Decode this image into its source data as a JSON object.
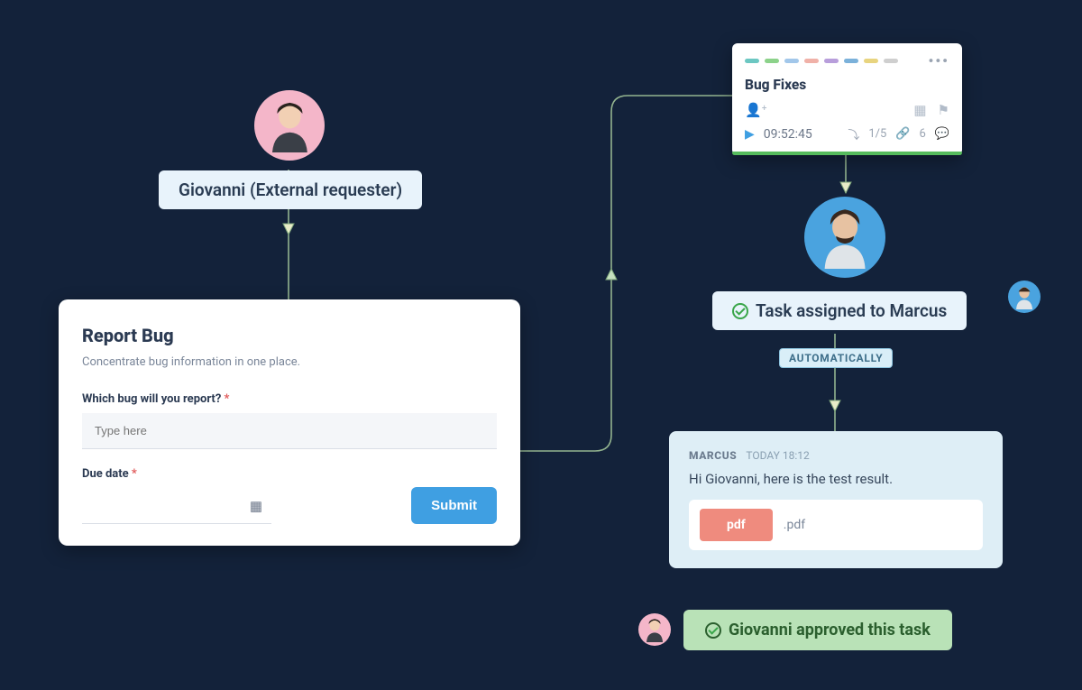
{
  "requester": {
    "label": "Giovanni (External requester)"
  },
  "form": {
    "title": "Report Bug",
    "description": "Concentrate bug information in one place.",
    "field1_label": "Which bug will you report?",
    "field1_placeholder": "Type here",
    "field2_label": "Due date",
    "submit_label": "Submit"
  },
  "task_card": {
    "title": "Bug Fixes",
    "timer": "09:52:45",
    "subtasks": "1/5",
    "attachments": "6",
    "stripe_colors": [
      "#6cc7c2",
      "#8cd28a",
      "#a2c7ea",
      "#f0b1a8",
      "#b89edb",
      "#7bb1da",
      "#e8d47f",
      "#cfcfcf"
    ]
  },
  "assigned": {
    "label": "Task assigned to Marcus"
  },
  "auto_badge": "AUTOMATICALLY",
  "message": {
    "sender": "MARCUS",
    "timestamp": "TODAY 18:12",
    "body": "Hi Giovanni, here is the test result.",
    "attach_label": "pdf",
    "attach_ext": ".pdf"
  },
  "approved": {
    "label": "Giovanni approved this task"
  }
}
